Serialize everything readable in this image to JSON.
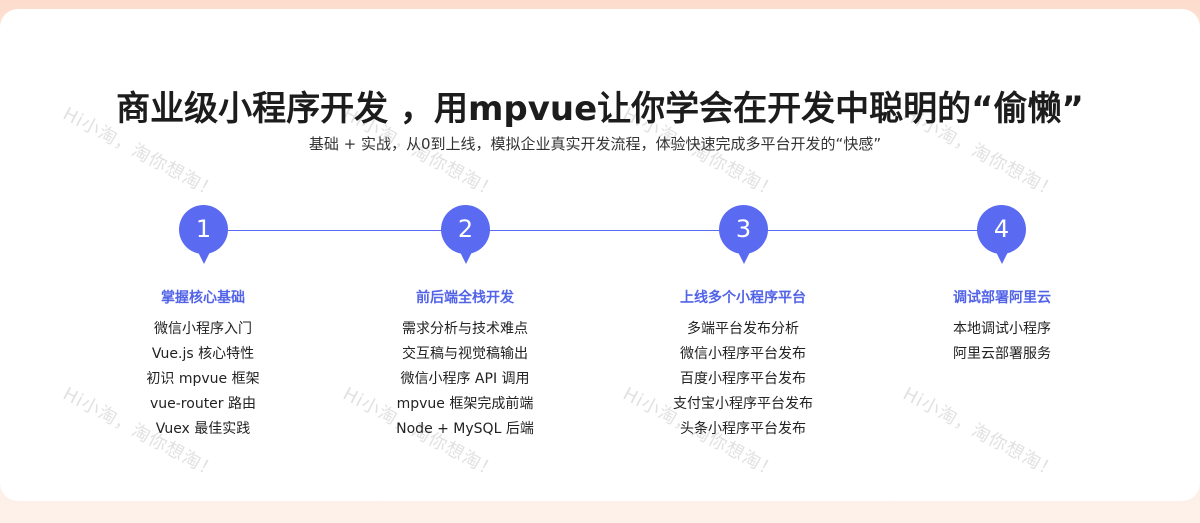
{
  "headline": "商业级小程序开发 ，用mpvue让你学会在开发中聪明的“偷懒”",
  "subheadline": "基础 + 实战，从0到上线，模拟企业真实开发流程，体验快速完成多平台开发的“快感”",
  "watermark": "Hi小淘，淘你想淘！",
  "accent_color": "#5a6bf2",
  "steps": [
    {
      "number": "1",
      "title": "掌握核心基础",
      "items": [
        "微信小程序入门",
        "Vue.js 核心特性",
        "初识 mpvue 框架",
        "vue-router 路由",
        "Vuex 最佳实践"
      ]
    },
    {
      "number": "2",
      "title": "前后端全栈开发",
      "items": [
        "需求分析与技术难点",
        "交互稿与视觉稿输出",
        "微信小程序 API 调用",
        "mpvue 框架完成前端",
        "Node + MySQL 后端"
      ]
    },
    {
      "number": "3",
      "title": "上线多个小程序平台",
      "items": [
        "多端平台发布分析",
        "微信小程序平台发布",
        "百度小程序平台发布",
        "支付宝小程序平台发布",
        "头条小程序平台发布"
      ]
    },
    {
      "number": "4",
      "title": "调试部署阿里云",
      "items": [
        "本地调试小程序",
        "阿里云部署服务"
      ]
    }
  ]
}
